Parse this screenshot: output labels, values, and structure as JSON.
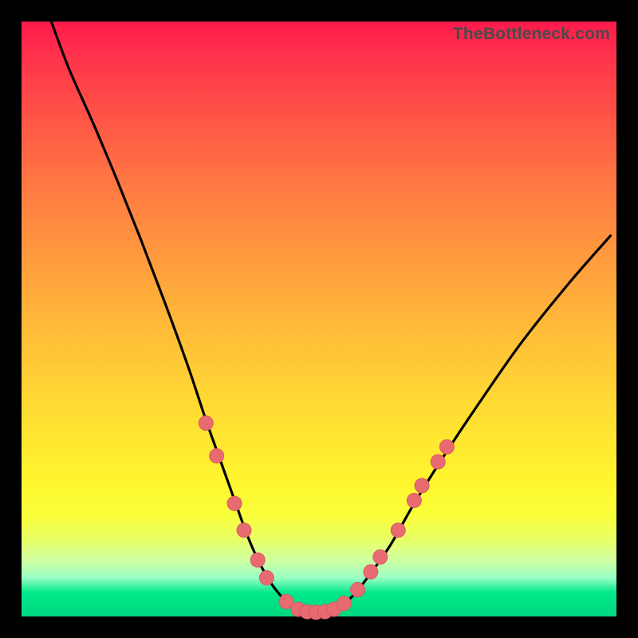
{
  "watermark": "TheBottleneck.com",
  "colors": {
    "frame": "#000000",
    "curve": "#000000",
    "marker_fill": "#e86b72",
    "marker_stroke": "#d95a62"
  },
  "chart_data": {
    "type": "line",
    "title": "",
    "xlabel": "",
    "ylabel": "",
    "xlim": [
      0,
      100
    ],
    "ylim": [
      0,
      100
    ],
    "series": [
      {
        "name": "bottleneck-curve",
        "x": [
          5,
          8,
          12,
          16,
          20,
          24,
          28,
          31,
          33.5,
          36,
          38,
          40,
          42,
          44,
          45.5,
          47,
          49,
          51,
          52.5,
          54,
          56,
          58.5,
          62,
          66,
          71,
          77,
          84,
          92,
          99
        ],
        "y": [
          100,
          92,
          83,
          73.5,
          63.5,
          53,
          42,
          33,
          26,
          19,
          13.5,
          9,
          5.5,
          3,
          1.5,
          0.8,
          0.5,
          0.6,
          1,
          2,
          3.8,
          7,
          12,
          19,
          27,
          36,
          46,
          56,
          64
        ]
      }
    ],
    "markers": [
      {
        "x": 31.0,
        "y": 32.5
      },
      {
        "x": 32.8,
        "y": 27.0
      },
      {
        "x": 35.8,
        "y": 19.0
      },
      {
        "x": 37.4,
        "y": 14.5
      },
      {
        "x": 39.7,
        "y": 9.5
      },
      {
        "x": 41.2,
        "y": 6.5
      },
      {
        "x": 44.5,
        "y": 2.5
      },
      {
        "x": 46.5,
        "y": 1.2
      },
      {
        "x": 48.0,
        "y": 0.8
      },
      {
        "x": 49.5,
        "y": 0.7
      },
      {
        "x": 51.0,
        "y": 0.8
      },
      {
        "x": 52.5,
        "y": 1.2
      },
      {
        "x": 54.2,
        "y": 2.2
      },
      {
        "x": 56.5,
        "y": 4.5
      },
      {
        "x": 58.7,
        "y": 7.5
      },
      {
        "x": 60.3,
        "y": 10.0
      },
      {
        "x": 63.3,
        "y": 14.5
      },
      {
        "x": 66.0,
        "y": 19.5
      },
      {
        "x": 67.3,
        "y": 22.0
      },
      {
        "x": 70.0,
        "y": 26.0
      },
      {
        "x": 71.5,
        "y": 28.5
      }
    ],
    "marker_radius": 9
  }
}
